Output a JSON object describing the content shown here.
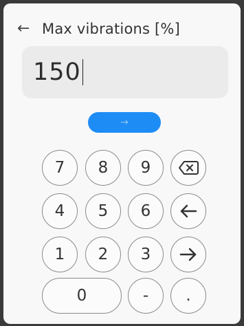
{
  "header": {
    "back_icon": "←",
    "title": "Max vibrations [%]"
  },
  "input": {
    "value": "150"
  },
  "submit": {
    "icon": "→"
  },
  "keypad": {
    "k7": "7",
    "k8": "8",
    "k9": "9",
    "k4": "4",
    "k5": "5",
    "k6": "6",
    "k1": "1",
    "k2": "2",
    "k3": "3",
    "k0": "0",
    "minus": "-",
    "dot": "."
  },
  "colors": {
    "accent": "#1e8cf5",
    "input_background": "#ebebeb"
  }
}
